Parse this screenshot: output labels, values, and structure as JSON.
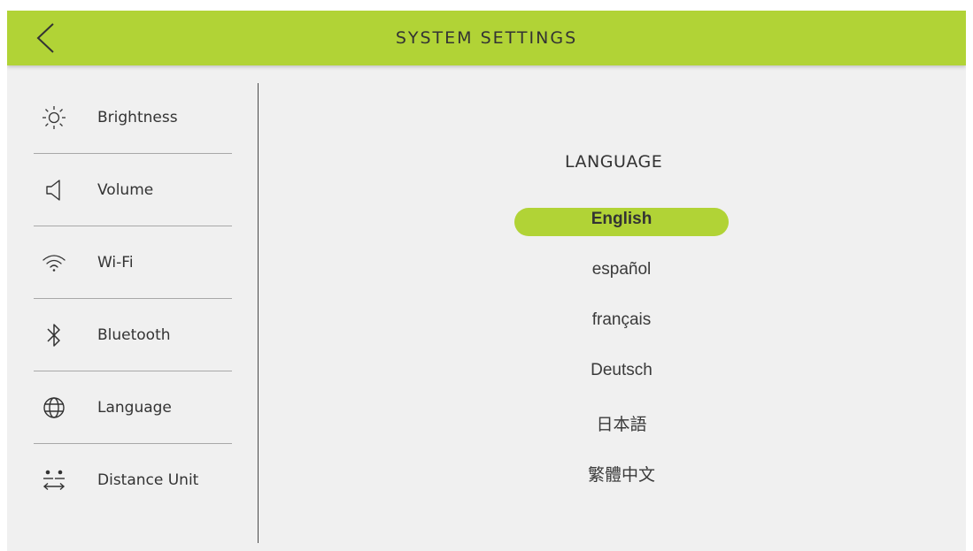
{
  "header": {
    "title": "SYSTEM SETTINGS",
    "back_icon": "chevron-left-icon",
    "color": "#b1d336"
  },
  "sidebar": {
    "items": [
      {
        "label": "Brightness",
        "icon": "brightness-icon"
      },
      {
        "label": "Volume",
        "icon": "speaker-icon"
      },
      {
        "label": "Wi-Fi",
        "icon": "wifi-icon"
      },
      {
        "label": "Bluetooth",
        "icon": "bluetooth-icon"
      },
      {
        "label": "Language",
        "icon": "globe-icon"
      },
      {
        "label": "Distance Unit",
        "icon": "distance-unit-icon"
      }
    ]
  },
  "language_panel": {
    "title": "LANGUAGE",
    "selected": "English",
    "options": [
      "English",
      "español",
      "français",
      "Deutsch",
      "日本語",
      "繁體中文"
    ]
  },
  "colors": {
    "accent": "#b1d336",
    "background": "#f0f0f0",
    "text": "#333333"
  }
}
